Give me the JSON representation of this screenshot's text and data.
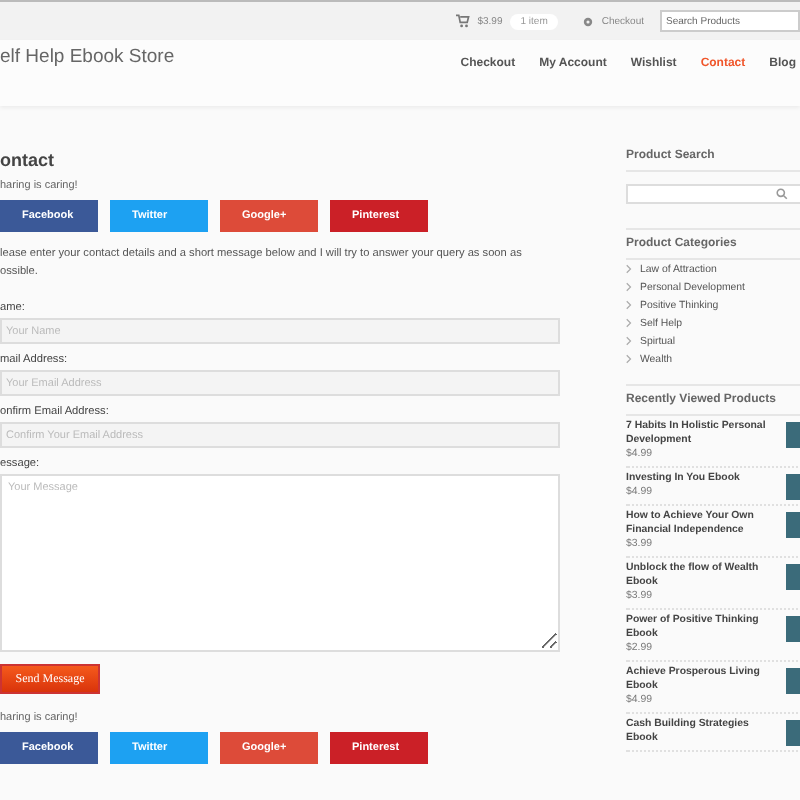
{
  "topbar": {
    "cart_total": "$3.99",
    "cart_count": "1 item",
    "checkout": "Checkout",
    "search": {
      "placeholder": "Search Products"
    }
  },
  "header": {
    "site_title": "elf Help Ebook Store",
    "nav": [
      {
        "label": "Checkout",
        "selected": false
      },
      {
        "label": "My Account",
        "selected": false
      },
      {
        "label": "Wishlist",
        "selected": false
      },
      {
        "label": "Contact",
        "selected": true
      },
      {
        "label": "Blog",
        "selected": false
      }
    ]
  },
  "content": {
    "heading": "ontact",
    "share_top": {
      "label": "haring is caring!",
      "buttons": [
        {
          "kind": "facebook",
          "label": "Facebook"
        },
        {
          "kind": "twitter",
          "label": "Twitter"
        },
        {
          "kind": "google",
          "label": "Google+"
        },
        {
          "kind": "pinterest",
          "label": "Pinterest"
        }
      ]
    },
    "intro": "lease enter your contact details and a short message below and I will try to answer your query as soon as\nossible.",
    "fields": [
      {
        "kind": "input",
        "label": "ame:",
        "placeholder": "Your Name"
      },
      {
        "kind": "input",
        "label": "mail Address:",
        "placeholder": "Your Email Address"
      },
      {
        "kind": "input",
        "label": "onfirm Email Address:",
        "placeholder": "Confirm Your Email Address"
      },
      {
        "kind": "textarea",
        "label": "essage:",
        "placeholder": "Your Message"
      }
    ],
    "submit": "Send Message",
    "share_bottom": {
      "label": "haring is caring!",
      "buttons": [
        {
          "kind": "facebook",
          "label": "Facebook"
        },
        {
          "kind": "twitter",
          "label": "Twitter"
        },
        {
          "kind": "google",
          "label": "Google+"
        },
        {
          "kind": "pinterest",
          "label": "Pinterest"
        }
      ]
    }
  },
  "sidebar": {
    "search_title": "Product Search",
    "categories_title": "Product Categories",
    "categories": [
      "Law of Attraction",
      "Personal Development",
      "Positive Thinking",
      "Self Help",
      "Spirtual",
      "Wealth"
    ],
    "recent_title": "Recently Viewed Products",
    "products": [
      {
        "title": "7 Habits In Holistic Personal Development",
        "price": "$4.99"
      },
      {
        "title": "Investing In You Ebook",
        "price": "$4.99"
      },
      {
        "title": "How to Achieve Your Own Financial Independence",
        "price": "$3.99"
      },
      {
        "title": "Unblock the flow of Wealth Ebook",
        "price": "$3.99"
      },
      {
        "title": "Power of Positive Thinking Ebook",
        "price": "$2.99"
      },
      {
        "title": "Achieve Prosperous Living Ebook",
        "price": "$4.99"
      },
      {
        "title": "Cash Building Strategies Ebook"
      }
    ]
  }
}
